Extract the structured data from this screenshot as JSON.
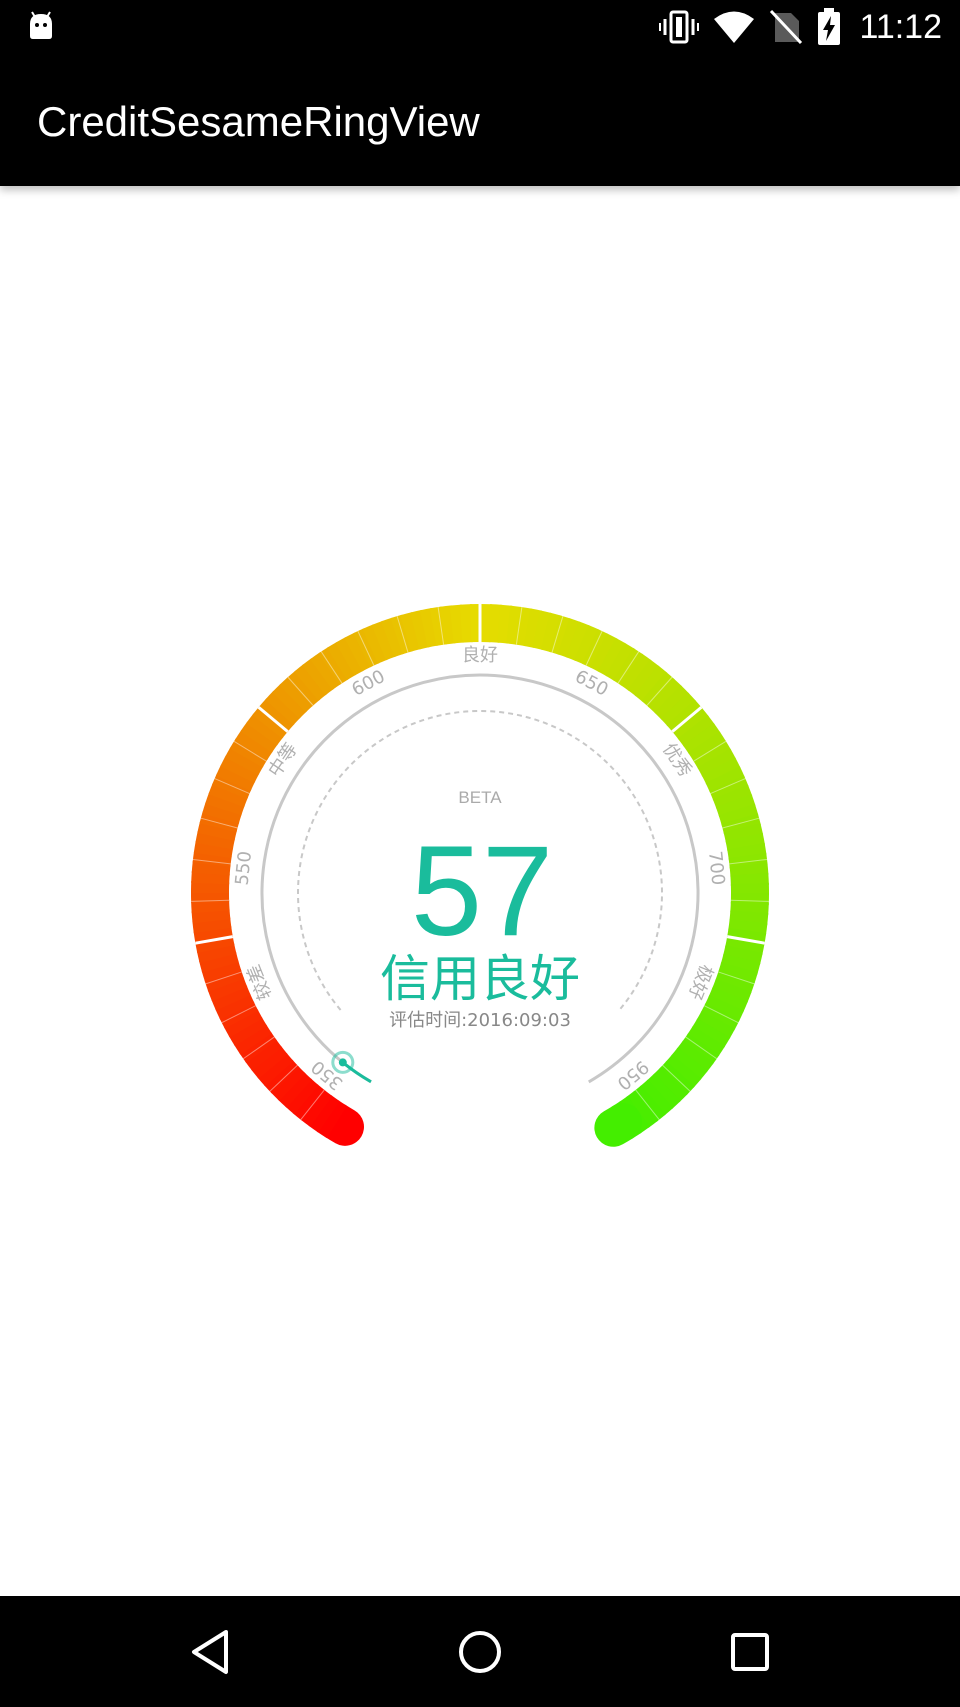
{
  "status_bar": {
    "time": "11:12",
    "icons": [
      "android-icon",
      "vibrate-icon",
      "wifi-icon",
      "no-sim-icon",
      "battery-charging-icon"
    ]
  },
  "app_bar": {
    "title": "CreditSesameRingView"
  },
  "gauge": {
    "beta_label": "BETA",
    "score": "57",
    "rating_text": "信用良好",
    "eval_time": "评估时间:2016:09:03",
    "scale_labels": [
      "350",
      "较差",
      "550",
      "中等",
      "600",
      "良好",
      "650",
      "优秀",
      "700",
      "极好",
      "950"
    ],
    "colors": {
      "start": "#ff0000",
      "mid": "#e6dc00",
      "end": "#44ee00",
      "accent": "#1abc9c",
      "ring_gray": "#c8c8c8",
      "label_gray": "#b0b0b0"
    }
  },
  "nav_bar": {
    "buttons": [
      "back-icon",
      "home-icon",
      "recents-icon"
    ]
  }
}
